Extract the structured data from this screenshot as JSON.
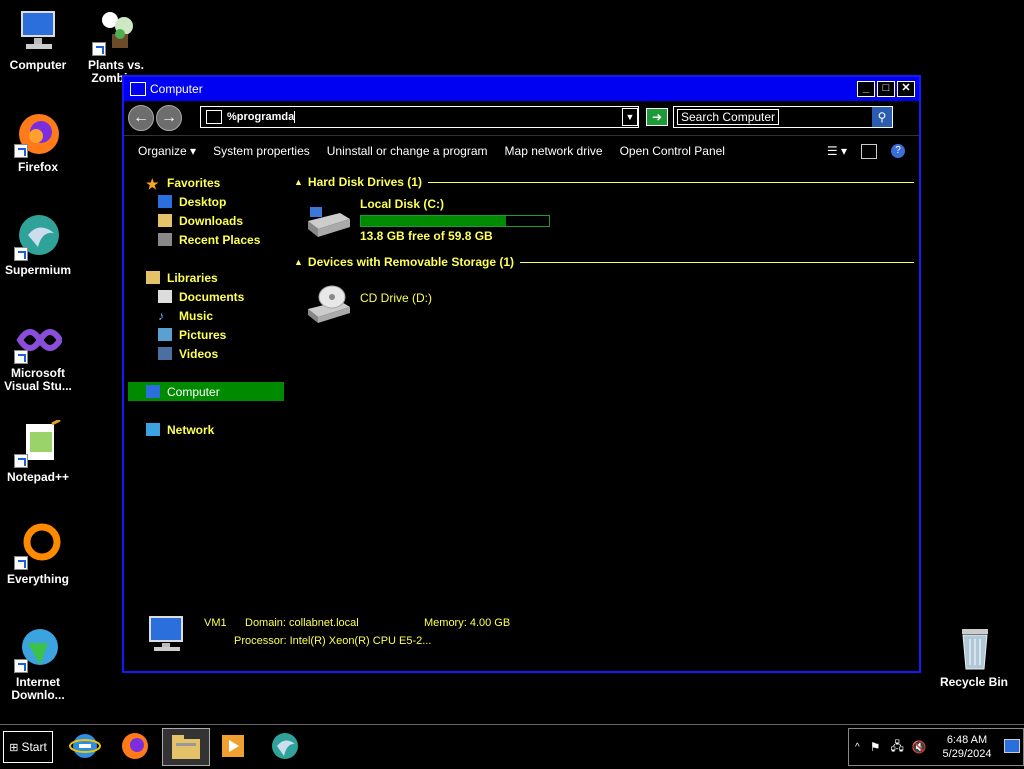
{
  "desktop": {
    "icons": [
      {
        "label": "Computer",
        "icon": "computer-icon"
      },
      {
        "label": "Plants vs.\nZombies",
        "icon": "plants-vs-zombies-icon"
      },
      {
        "label": "Firefox",
        "icon": "firefox-icon"
      },
      {
        "label": "Supermium",
        "icon": "supermium-icon"
      },
      {
        "label": "Microsoft\nVisual Stu...",
        "icon": "visual-studio-icon"
      },
      {
        "label": "Notepad++",
        "icon": "notepadpp-icon"
      },
      {
        "label": "Everything",
        "icon": "everything-icon"
      },
      {
        "label": "Internet\nDownlo...",
        "icon": "internet-download-manager-icon"
      },
      {
        "label": "Recycle Bin",
        "icon": "recycle-bin-icon"
      }
    ]
  },
  "window": {
    "title": "Computer",
    "address_value": "%programda",
    "search_placeholder": "Search Computer",
    "commands": [
      "Organize",
      "System properties",
      "Uninstall or change a program",
      "Map network drive",
      "Open Control Panel"
    ],
    "nav": {
      "favorites": "Favorites",
      "desktop": "Desktop",
      "downloads": "Downloads",
      "recent": "Recent Places",
      "libraries": "Libraries",
      "documents": "Documents",
      "music": "Music",
      "pictures": "Pictures",
      "videos": "Videos",
      "computer": "Computer",
      "network": "Network"
    },
    "groups": {
      "hdd": "Hard Disk Drives (1)",
      "removable": "Devices with Removable Storage (1)"
    },
    "drives": {
      "c_name": "Local Disk (C:)",
      "c_free": "13.8 GB free of 59.8 GB",
      "c_used_fraction": 0.77,
      "d_name": "CD Drive (D:)"
    },
    "details": {
      "name": "VM1",
      "domain": "Domain: collabnet.local",
      "memory": "Memory: 4.00 GB",
      "processor": "Processor: Intel(R) Xeon(R) CPU E5-2..."
    }
  },
  "taskbar": {
    "start": "Start",
    "time": "6:48 AM",
    "date": "5/29/2024"
  },
  "colors": {
    "accent": "#0000f2",
    "text_yellow": "#ffff55",
    "select_green": "#008a00"
  }
}
